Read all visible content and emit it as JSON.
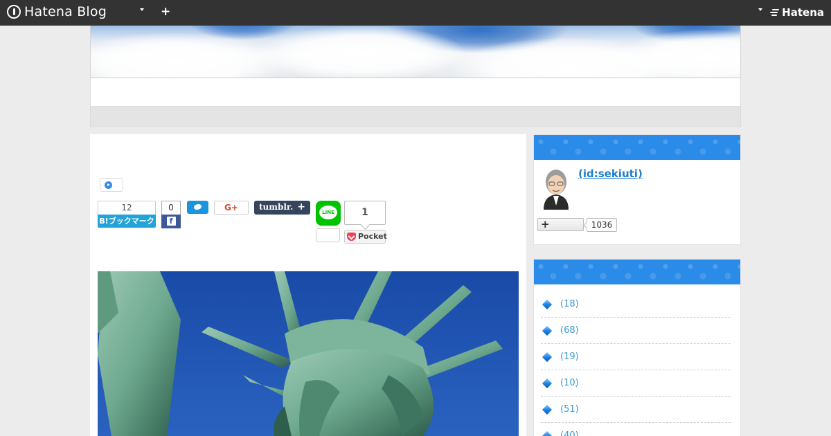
{
  "topbar": {
    "logo_text": "Hatena Blog",
    "logo_icon": "hatena-blog-logo-icon",
    "add_label": "+",
    "brand_text": "Hatena"
  },
  "share": {
    "hatebu_count": "12",
    "hatebu_label": "B!ブックマーク",
    "facebook_count": "0",
    "facebook_glyph": "f",
    "googleplus_label": "G+",
    "tumblr_label": "tumblr.",
    "tumblr_plus": "+",
    "line_label": "LINE",
    "pocket_count": "1",
    "pocket_label": "Pocket"
  },
  "profile": {
    "id_label": " (id:sekiuti)",
    "follow_label": "+",
    "follower_count": "1036"
  },
  "categories": [
    {
      "count": "(18)"
    },
    {
      "count": "(68)"
    },
    {
      "count": "(19)"
    },
    {
      "count": "(10)"
    },
    {
      "count": "(51)"
    },
    {
      "count": "(40)"
    }
  ],
  "colors": {
    "topbar": "#333333",
    "sidebar_header": "#2a8be8",
    "hatebu": "#22a3d9",
    "facebook": "#3b5998",
    "twitter": "#1b95e0",
    "tumblr": "#35465c",
    "line": "#00c300",
    "pocket": "#ef4056"
  }
}
